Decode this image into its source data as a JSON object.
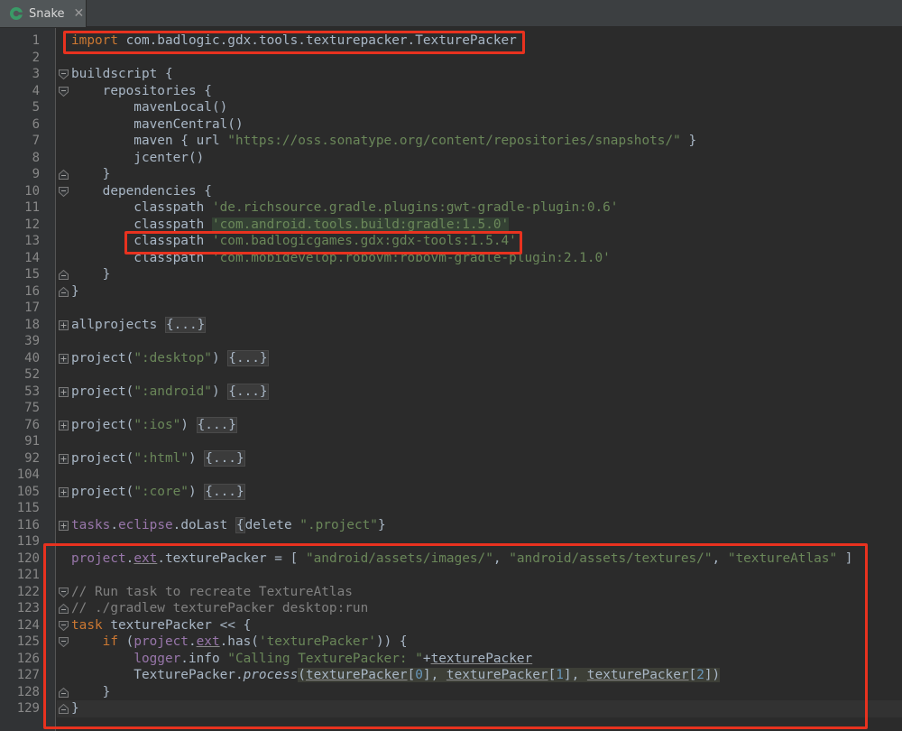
{
  "tab": {
    "title": "Snake",
    "close_glyph": "✕",
    "icon": "gradle-icon"
  },
  "lines": [
    {
      "n": "1",
      "segs": [
        [
          "kw",
          "import "
        ],
        [
          "",
          "com.badlogic.gdx.tools.texturepacker.TexturePacker"
        ]
      ]
    },
    {
      "n": "2",
      "segs": []
    },
    {
      "n": "3",
      "fold": "open",
      "segs": [
        [
          "",
          "buildscript {"
        ]
      ]
    },
    {
      "n": "4",
      "fold": "open",
      "segs": [
        [
          "",
          "    repositories {"
        ]
      ]
    },
    {
      "n": "5",
      "segs": [
        [
          "",
          "        mavenLocal()"
        ]
      ]
    },
    {
      "n": "6",
      "segs": [
        [
          "",
          "        mavenCentral()"
        ]
      ]
    },
    {
      "n": "7",
      "segs": [
        [
          "",
          "        maven { url "
        ],
        [
          "str",
          "\"https://oss.sonatype.org/content/repositories/snapshots/\""
        ],
        [
          "",
          " }"
        ]
      ]
    },
    {
      "n": "8",
      "segs": [
        [
          "",
          "        jcenter()"
        ]
      ]
    },
    {
      "n": "9",
      "fold": "close",
      "segs": [
        [
          "",
          "    }"
        ]
      ]
    },
    {
      "n": "10",
      "fold": "open",
      "segs": [
        [
          "",
          "    dependencies {"
        ]
      ]
    },
    {
      "n": "11",
      "segs": [
        [
          "",
          "        classpath "
        ],
        [
          "str",
          "'de.richsource.gradle.plugins:gwt-gradle-plugin:0.6'"
        ]
      ]
    },
    {
      "n": "12",
      "segs": [
        [
          "",
          "        classpath "
        ],
        [
          "strhl",
          "'com.android.tools.build:gradle:1.5.0'"
        ]
      ]
    },
    {
      "n": "13",
      "segs": [
        [
          "",
          "        classpath "
        ],
        [
          "str",
          "'com.badlogicgames.gdx:gdx-tools:1.5.4'"
        ]
      ]
    },
    {
      "n": "14",
      "segs": [
        [
          "",
          "        classpath "
        ],
        [
          "str",
          "'com.mobidevelop.robovm:robovm-gradle-plugin:2.1.0'"
        ]
      ]
    },
    {
      "n": "15",
      "fold": "close",
      "segs": [
        [
          "",
          "    }"
        ]
      ]
    },
    {
      "n": "16",
      "fold": "close",
      "segs": [
        [
          "",
          "}"
        ]
      ]
    },
    {
      "n": "17",
      "segs": []
    },
    {
      "n": "18",
      "fold": "plus",
      "segs": [
        [
          "",
          "allprojects "
        ],
        [
          "fold-hint",
          "{...}"
        ]
      ]
    },
    {
      "n": "39",
      "segs": []
    },
    {
      "n": "40",
      "fold": "plus",
      "segs": [
        [
          "",
          "project("
        ],
        [
          "str",
          "\":desktop\""
        ],
        [
          "",
          ") "
        ],
        [
          "fold-hint",
          "{...}"
        ]
      ]
    },
    {
      "n": "52",
      "segs": []
    },
    {
      "n": "53",
      "fold": "plus",
      "segs": [
        [
          "",
          "project("
        ],
        [
          "str",
          "\":android\""
        ],
        [
          "",
          ") "
        ],
        [
          "fold-hint",
          "{...}"
        ]
      ]
    },
    {
      "n": "75",
      "segs": []
    },
    {
      "n": "76",
      "fold": "plus",
      "segs": [
        [
          "",
          "project("
        ],
        [
          "str",
          "\":ios\""
        ],
        [
          "",
          ") "
        ],
        [
          "fold-hint",
          "{...}"
        ]
      ]
    },
    {
      "n": "91",
      "segs": []
    },
    {
      "n": "92",
      "fold": "plus",
      "segs": [
        [
          "",
          "project("
        ],
        [
          "str",
          "\":html\""
        ],
        [
          "",
          ") "
        ],
        [
          "fold-hint",
          "{...}"
        ]
      ]
    },
    {
      "n": "104",
      "segs": []
    },
    {
      "n": "105",
      "fold": "plus",
      "segs": [
        [
          "",
          "project("
        ],
        [
          "str",
          "\":core\""
        ],
        [
          "",
          ") "
        ],
        [
          "fold-hint",
          "{...}"
        ]
      ]
    },
    {
      "n": "115",
      "segs": []
    },
    {
      "n": "116",
      "fold": "plus",
      "segs": [
        [
          "prop",
          "tasks"
        ],
        [
          "",
          "."
        ],
        [
          "prop",
          "eclipse"
        ],
        [
          "",
          ".doLast "
        ],
        [
          "fold-hint",
          "{"
        ],
        [
          "",
          "delete "
        ],
        [
          "str",
          "\".project\""
        ],
        [
          "",
          "}"
        ]
      ]
    },
    {
      "n": "119",
      "segs": []
    },
    {
      "n": "120",
      "segs": [
        [
          "prop",
          "project"
        ],
        [
          "",
          "."
        ],
        [
          "prop u",
          "ext"
        ],
        [
          "",
          ".texturePacker = [ "
        ],
        [
          "str",
          "\"android/assets/images/\""
        ],
        [
          "",
          ", "
        ],
        [
          "str",
          "\"android/assets/textures/\""
        ],
        [
          "",
          ", "
        ],
        [
          "str",
          "\"textureAtlas\""
        ],
        [
          "",
          " ]"
        ]
      ]
    },
    {
      "n": "121",
      "segs": []
    },
    {
      "n": "122",
      "fold": "open",
      "segs": [
        [
          "cmt",
          "// Run task to recreate TextureAtlas"
        ]
      ]
    },
    {
      "n": "123",
      "fold": "close",
      "segs": [
        [
          "cmt",
          "// ./gradlew texturePacker desktop:run"
        ]
      ]
    },
    {
      "n": "124",
      "fold": "open",
      "segs": [
        [
          "kw",
          "task"
        ],
        [
          "",
          " texturePacker << {"
        ]
      ]
    },
    {
      "n": "125",
      "fold": "open",
      "segs": [
        [
          "",
          "    "
        ],
        [
          "kw",
          "if"
        ],
        [
          "",
          " ("
        ],
        [
          "prop",
          "project"
        ],
        [
          "",
          "."
        ],
        [
          "prop u",
          "ext"
        ],
        [
          "",
          ".has("
        ],
        [
          "str",
          "'texturePacker'"
        ],
        [
          "",
          ")) {"
        ]
      ]
    },
    {
      "n": "126",
      "segs": [
        [
          "",
          "        "
        ],
        [
          "prop",
          "logger"
        ],
        [
          "",
          ".info "
        ],
        [
          "str",
          "\"Calling TexturePacker: \""
        ],
        [
          "",
          "+"
        ],
        [
          "u",
          "texturePacker"
        ]
      ]
    },
    {
      "n": "127",
      "segs": [
        [
          "",
          "        TexturePacker."
        ],
        [
          "fn",
          "process"
        ],
        [
          "hlarg",
          "("
        ],
        [
          "hlarg u",
          "texturePacker"
        ],
        [
          "hlarg",
          "["
        ],
        [
          "hlarg num",
          "0"
        ],
        [
          "hlarg",
          "], "
        ],
        [
          "hlarg u",
          "texturePacker"
        ],
        [
          "hlarg",
          "["
        ],
        [
          "hlarg num",
          "1"
        ],
        [
          "hlarg",
          "], "
        ],
        [
          "hlarg u",
          "texturePacker"
        ],
        [
          "hlarg",
          "["
        ],
        [
          "hlarg num",
          "2"
        ],
        [
          "hlarg",
          "])"
        ]
      ]
    },
    {
      "n": "128",
      "fold": "close",
      "segs": [
        [
          "",
          "    }"
        ]
      ]
    },
    {
      "n": "129",
      "fold": "close",
      "current": true,
      "segs": [
        [
          "",
          "}"
        ]
      ]
    }
  ]
}
